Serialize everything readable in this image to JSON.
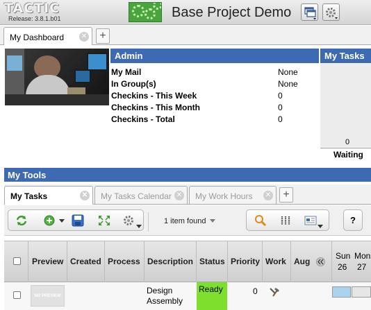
{
  "app": {
    "logo": "TACTIC",
    "release": "Release: 3.8.1.b01",
    "project_title": "Base Project Demo"
  },
  "main_tabs": [
    {
      "label": "My Dashboard"
    }
  ],
  "admin": {
    "title": "Admin",
    "rows": [
      {
        "label": "My Mail",
        "value": "None"
      },
      {
        "label": "In Group(s)",
        "value": "None"
      },
      {
        "label": "Checkins - This Week",
        "value": "0"
      },
      {
        "label": "Checkins - This Month",
        "value": "0"
      },
      {
        "label": "Checkins - Total",
        "value": "0"
      }
    ]
  },
  "my_tasks_panel": {
    "title": "My Tasks",
    "count": "0",
    "label": "Waiting"
  },
  "tools": {
    "title": "My Tools",
    "tabs": [
      {
        "label": "My Tasks"
      },
      {
        "label": "My Tasks Calendar"
      },
      {
        "label": "My Work Hours"
      }
    ],
    "items_found": "1 item found",
    "help": "?"
  },
  "table": {
    "headers": [
      "Preview",
      "Created",
      "Process",
      "Description",
      "Status",
      "Priority",
      "Work",
      "Aug"
    ],
    "calendar_days": [
      {
        "day": "Sun",
        "num": "26"
      },
      {
        "day": "Mon",
        "num": "27"
      }
    ],
    "rows": [
      {
        "preview": "NO PREVIEW",
        "description_line1": "Design",
        "description_line2": "Assembly",
        "status": "Ready",
        "status_color": "#7ee02c",
        "priority": "0"
      }
    ]
  },
  "colors": {
    "header_blue": "#3d6ab3"
  }
}
